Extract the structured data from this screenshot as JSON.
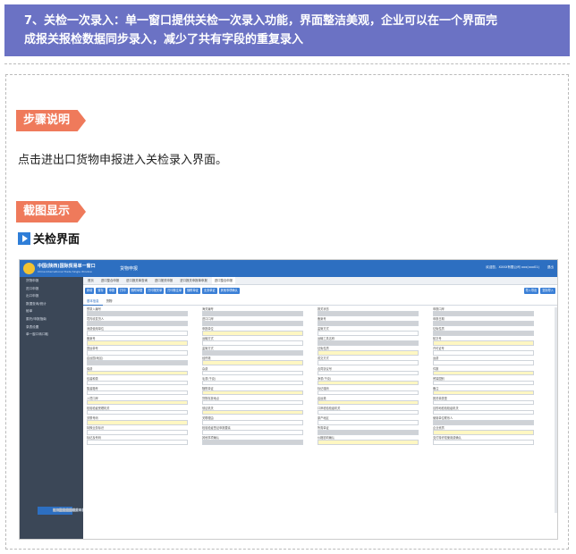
{
  "banner": {
    "line1": "7、关检一次录入：单一窗口提供关检一次录入功能，界面整洁美观，企业可以在一个界面完",
    "line2": "成报关报检数据同步录入，减少了共有字段的重复录入"
  },
  "section1": {
    "label": "步骤说明",
    "text": "点击进出口货物申报进入关检录入界面。"
  },
  "section2": {
    "label": "截图显示",
    "subtitle": "关检界面"
  },
  "screenshot": {
    "brand": "中国(陕西)国际贸易单一窗口",
    "brand_en": "China International Trade Single Window",
    "system": "货物申报",
    "user": "欢迎您，XXXX有限公司 xxx(xxx01)",
    "logout": "退出",
    "sidebar": [
      {
        "label": "货物申报",
        "level": 1,
        "active": false
      },
      {
        "label": "进口申报",
        "level": 1,
        "active": false
      },
      {
        "label": "进口整合申报",
        "level": 2,
        "active": true
      },
      {
        "label": "进口报关单查询",
        "level": 2,
        "active": false
      },
      {
        "label": "入境检验检疫",
        "level": 2,
        "active": false
      },
      {
        "label": "回执数据查询申报",
        "level": 2,
        "active": false
      },
      {
        "label": "进口转关提前报关申报",
        "level": 2,
        "active": false
      },
      {
        "label": "进口进境货物转关申报",
        "level": 2,
        "active": false
      },
      {
        "label": "进口直接转关申报",
        "level": 2,
        "active": false
      },
      {
        "label": "进口转关提前报关申报",
        "level": 2,
        "active": false
      },
      {
        "label": "出口申报",
        "level": 1,
        "active": false
      },
      {
        "label": "数据查询/统计",
        "level": 1,
        "active": false
      },
      {
        "label": "舱单",
        "level": 1,
        "active": false
      },
      {
        "label": "委托/申报指南",
        "level": 1,
        "active": false
      },
      {
        "label": "录表设置",
        "level": 1,
        "active": false
      },
      {
        "label": "单一窗口转口取",
        "level": 1,
        "active": false
      }
    ],
    "tabs": [
      "首页",
      "进口整合申报",
      "进口报关单查询",
      "进口报关申报",
      "进口报关申报单申报",
      "进口整合申报"
    ],
    "buttons": [
      "新增",
      "暂存",
      "申报",
      "打印",
      "随附单据",
      "打印报关单",
      "打印核注单",
      "随附单证",
      "业务单证",
      "其他事项确认"
    ],
    "buttons_right": [
      "导入导出",
      "复制导入"
    ],
    "subtabs": [
      "基本信息",
      "货物"
    ],
    "form_rows": [
      [
        "预录入编号",
        "海关编号",
        "报关状态",
        "申报口岸"
      ],
      [
        "境内收发货人",
        "进口口岸",
        "备案号",
        "申报日期"
      ],
      [
        "消费使用单位",
        "申报单位",
        "监管方式",
        "征免性质"
      ],
      [
        "备案号",
        "运输方式",
        "运输工具名称",
        "航次号"
      ],
      [
        "提运单号",
        "监管方式",
        "征免性质",
        "许可证号"
      ],
      [
        "启运国(地区)",
        "经停港",
        "成交方式",
        "运费"
      ],
      [
        "保费",
        "杂费",
        "合同协议号",
        "件数"
      ],
      [
        "包装种类",
        "毛重(千克)",
        "净重(千克)",
        "贸易国别"
      ],
      [
        "集装箱号",
        "随附单证",
        "标记唛码",
        "备注"
      ],
      [
        "入境口岸",
        "货物存放地点",
        "启运港",
        "报关单类型"
      ],
      [
        "检验检疫受理机关",
        "领证机关",
        "口岸检验检疫机关",
        "目的地检验检疫机关"
      ],
      [
        "关联号码",
        "关联理由",
        "原产地区",
        "使用单位联系人"
      ],
      [
        "特殊业务标识",
        "检验检疫签证申报要素",
        "所需单证",
        "企业资质"
      ],
      [
        "标记及号码",
        "其他事项确认",
        "价格影响确认",
        "支付特许权使用费确认"
      ]
    ]
  }
}
